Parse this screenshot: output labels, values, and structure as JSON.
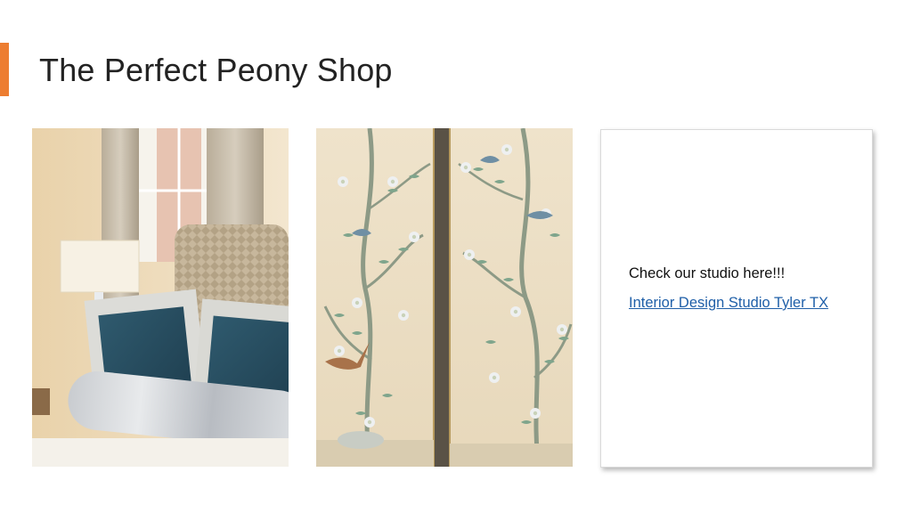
{
  "slide": {
    "title": "The Perfect Peony Shop",
    "accent_color": "#ED7D31"
  },
  "images": [
    {
      "name": "bedroom-pillows-photo",
      "alt": "Bedroom with blue velvet pillows, woven headboard and lamp"
    },
    {
      "name": "chinoiserie-panels-photo",
      "alt": "Hand-painted chinoiserie panels with birds and blossoms"
    }
  ],
  "card": {
    "text": "Check our studio here!!!",
    "link_text": "Interior Design Studio Tyler TX",
    "link_color": "#1F5FA8"
  }
}
